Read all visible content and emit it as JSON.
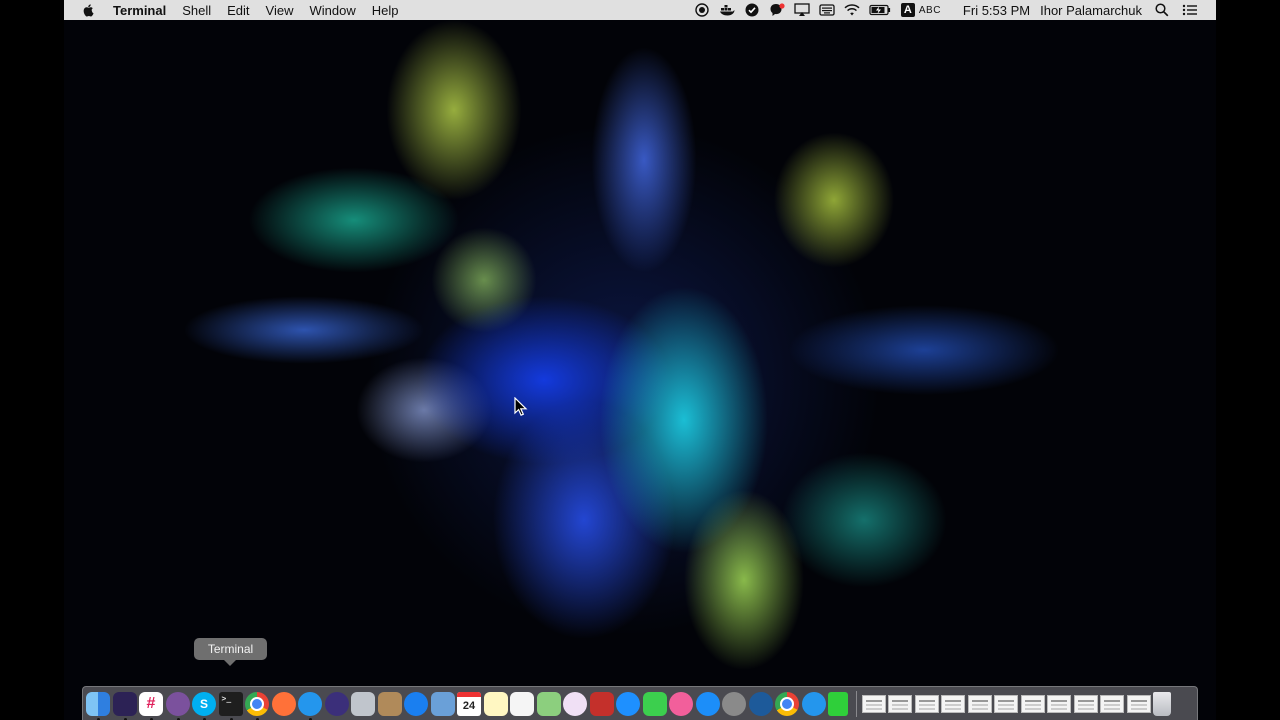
{
  "menubar": {
    "app_name": "Terminal",
    "menus": [
      "Shell",
      "Edit",
      "View",
      "Window",
      "Help"
    ],
    "input_source": {
      "letter": "A",
      "label": "ABC"
    },
    "clock": "Fri 5:53 PM",
    "user": "Ihor Palamarchuk",
    "status_icons": [
      "record-icon",
      "docker-icon",
      "todo-check-icon",
      "viber-icon",
      "airplay-icon",
      "keyboard-icon",
      "wifi-icon",
      "battery-icon",
      "spotlight-icon",
      "notification-center-icon"
    ]
  },
  "dock": {
    "tooltip": "Terminal",
    "calendar_day": "24",
    "apps": [
      {
        "name": "finder",
        "color": "#3a8ee6",
        "running": true
      },
      {
        "name": "eclipse",
        "color": "#2c2255",
        "running": true
      },
      {
        "name": "slack",
        "color": "#ffffff",
        "running": true
      },
      {
        "name": "viber",
        "color": "#7b519d",
        "running": true
      },
      {
        "name": "skype",
        "color": "#00aff0",
        "running": true
      },
      {
        "name": "terminal",
        "color": "#1e1e1e",
        "running": true
      },
      {
        "name": "chrome",
        "color": "#ffffff",
        "running": true
      },
      {
        "name": "firefox",
        "color": "#ff7139",
        "running": false
      },
      {
        "name": "docker",
        "color": "#2496ed",
        "running": true
      },
      {
        "name": "siri",
        "color": "#3b2f7a",
        "running": false
      },
      {
        "name": "launchpad",
        "color": "#c0c5cc",
        "running": false
      },
      {
        "name": "contacts",
        "color": "#b08a5a",
        "running": false
      },
      {
        "name": "safari",
        "color": "#1a7ff0",
        "running": false
      },
      {
        "name": "preview",
        "color": "#6aa0d8",
        "running": false
      },
      {
        "name": "calendar",
        "color": "#ffffff",
        "running": false
      },
      {
        "name": "notes",
        "color": "#fff7c2",
        "running": false
      },
      {
        "name": "reminders",
        "color": "#f5f5f5",
        "running": false
      },
      {
        "name": "maps",
        "color": "#8ccf7e",
        "running": false
      },
      {
        "name": "photos",
        "color": "#f0e0f5",
        "running": false
      },
      {
        "name": "photo-booth",
        "color": "#c4302b",
        "running": false
      },
      {
        "name": "messages-alt",
        "color": "#1e90ff",
        "running": false
      },
      {
        "name": "facetime",
        "color": "#3ccf4e",
        "running": false
      },
      {
        "name": "itunes",
        "color": "#f25f9b",
        "running": false
      },
      {
        "name": "app-store",
        "color": "#1c8ef9",
        "running": false
      },
      {
        "name": "system-preferences",
        "color": "#8a8a8a",
        "running": false
      },
      {
        "name": "quicktime",
        "color": "#1d5a9a",
        "running": false
      },
      {
        "name": "chrome-alt",
        "color": "#ffffff",
        "running": false
      },
      {
        "name": "docker-alt",
        "color": "#2496ed",
        "running": false
      },
      {
        "name": "battery-app",
        "color": "#2fcf3a",
        "running": false
      }
    ],
    "documents": 11
  }
}
